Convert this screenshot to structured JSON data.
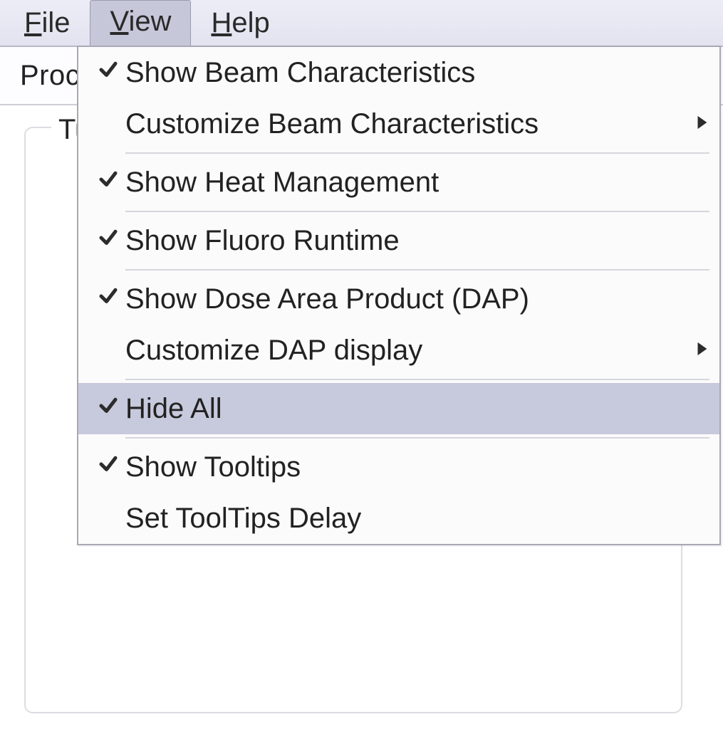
{
  "menubar": {
    "file": {
      "label": "File",
      "accel_index": 0
    },
    "view": {
      "label": "View",
      "accel_index": 0
    },
    "help": {
      "label": "Help",
      "accel_index": 0
    }
  },
  "tabrow": {
    "tab_fragment_left": "Proc",
    "tab_fragment_right": ""
  },
  "groupbox": {
    "label_fragment": "Tu"
  },
  "view_menu": {
    "items": [
      {
        "label": "Show Beam Characteristics",
        "checked": true,
        "has_submenu": false
      },
      {
        "label": "Customize Beam Characteristics",
        "checked": false,
        "has_submenu": true
      },
      {
        "separator": true
      },
      {
        "label": "Show Heat Management",
        "checked": true,
        "has_submenu": false
      },
      {
        "separator": true
      },
      {
        "label": "Show Fluoro Runtime",
        "checked": true,
        "has_submenu": false
      },
      {
        "separator": true
      },
      {
        "label": "Show Dose Area Product (DAP)",
        "checked": true,
        "has_submenu": false
      },
      {
        "label": "Customize DAP display",
        "checked": false,
        "has_submenu": true
      },
      {
        "separator": true
      },
      {
        "label": "Hide All",
        "checked": true,
        "has_submenu": false,
        "highlight": true
      },
      {
        "separator": true
      },
      {
        "label": "Show Tooltips",
        "checked": true,
        "has_submenu": false
      },
      {
        "label": "Set ToolTips Delay",
        "checked": false,
        "has_submenu": false
      }
    ]
  }
}
